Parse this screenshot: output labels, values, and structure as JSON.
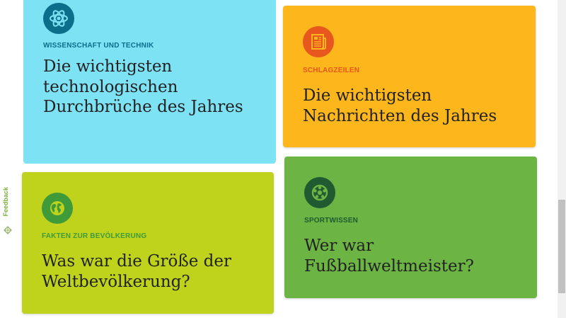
{
  "cards": [
    {
      "category": "Wissenschaft und Technik",
      "headline": "Die wichtigsten technologischen Durchbrüche des Jahres",
      "icon": "atom-icon",
      "background": "#7ee2f5",
      "accent": "#0b6e8a"
    },
    {
      "category": "Schlagzeilen",
      "headline": "Die wichtigsten Nachrichten des Jahres",
      "icon": "newspaper-icon",
      "background": "#fdb71c",
      "accent": "#e8571e"
    },
    {
      "category": "Fakten zur Bevölkerung",
      "headline": "Was war die Größe der Weltbevölkerung?",
      "icon": "globe-icon",
      "background": "#bfd31c",
      "accent": "#3f9a3a"
    },
    {
      "category": "Sportwissen",
      "headline": "Wer war Fußballweltmeister?",
      "icon": "soccer-ball-icon",
      "background": "#6cb443",
      "accent": "#1f5a30"
    }
  ],
  "feedback": {
    "label": "Feedback"
  }
}
